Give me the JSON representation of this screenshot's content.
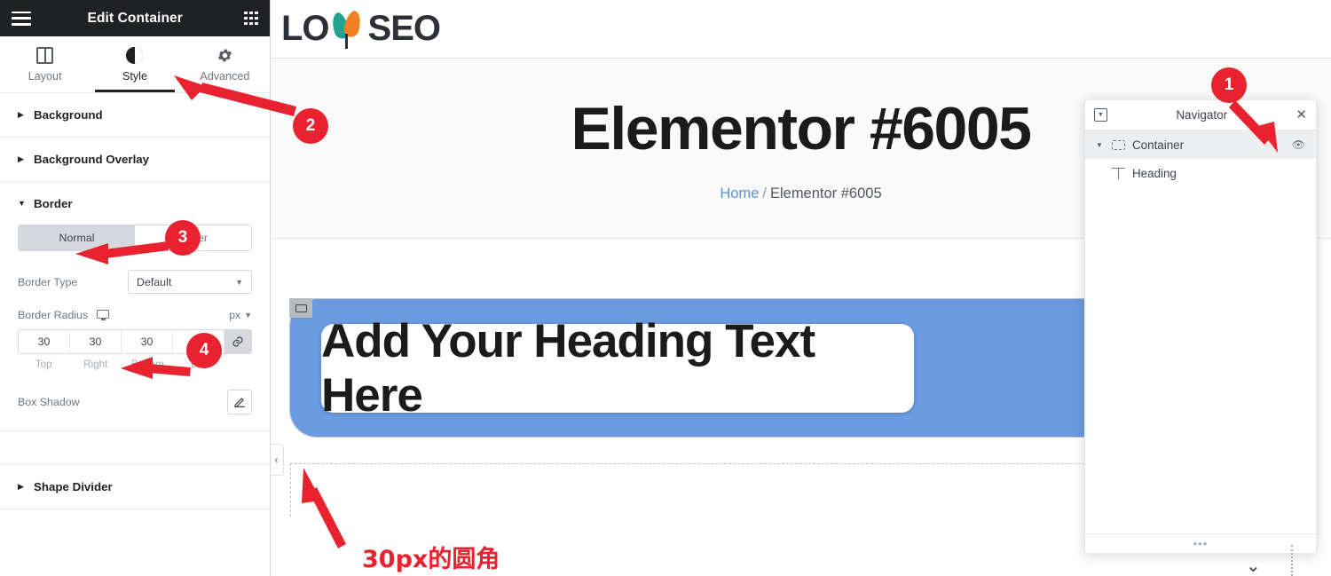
{
  "panel": {
    "title": "Edit Container",
    "menu_icon": "hamburger-icon",
    "apps_icon": "apps-grid-icon",
    "tabs": [
      {
        "label": "Layout",
        "icon": "columns-icon",
        "active": false
      },
      {
        "label": "Style",
        "icon": "contrast-icon",
        "active": true
      },
      {
        "label": "Advanced",
        "icon": "gear-icon",
        "active": false
      }
    ],
    "sections": [
      {
        "label": "Background",
        "expanded": false
      },
      {
        "label": "Background Overlay",
        "expanded": false
      },
      {
        "label": "Border",
        "expanded": true
      },
      {
        "label": "Shape Divider",
        "expanded": false
      }
    ],
    "border": {
      "state_tabs": [
        {
          "label": "Normal",
          "active": true
        },
        {
          "label": "Hover",
          "active": false
        }
      ],
      "border_type_label": "Border Type",
      "border_type_value": "Default",
      "border_radius_label": "Border Radius",
      "device_icon": "monitor-icon",
      "unit": "px",
      "radius_values": [
        "30",
        "30",
        "30",
        "30"
      ],
      "radius_labels": [
        "Top",
        "Right",
        "Bottom",
        "Left"
      ],
      "link_icon": "link-icon",
      "box_shadow_label": "Box Shadow",
      "box_shadow_edit_icon": "pencil-icon"
    },
    "collapse_icon": "chevron-left-icon"
  },
  "site": {
    "logo_text_left": "LO",
    "logo_text_right": "SEO",
    "logo_leaf_colors": {
      "left": "#22a390",
      "right": "#ef8023"
    },
    "page_title": "Elementor #6005",
    "breadcrumb": {
      "home": "Home",
      "separator": "/",
      "current": "Elementor #6005"
    }
  },
  "canvas": {
    "container_handle_icon": "container-icon",
    "container_color": "#6a9ae0",
    "container_radius_px": 30,
    "heading_text": "Add Your Heading Text Here"
  },
  "navigator": {
    "dock_icon": "dock-icon",
    "title": "Navigator",
    "close_icon": "close-icon",
    "items": [
      {
        "label": "Container",
        "icon": "container-icon",
        "selected": true,
        "visibility_icon": "eye-icon",
        "caret": "chevron-down-icon"
      },
      {
        "label": "Heading",
        "icon": "heading-icon",
        "selected": false
      }
    ],
    "resize_handle": "•••",
    "bottom_chevron_icon": "chevron-down-icon"
  },
  "annotations": {
    "accent_color": "#e8222e",
    "badges": [
      {
        "number": "1",
        "target": "navigator-container-item"
      },
      {
        "number": "2",
        "target": "style-tab"
      },
      {
        "number": "3",
        "target": "border-section"
      },
      {
        "number": "4",
        "target": "border-radius-control"
      }
    ],
    "note_text": "30px的圆角"
  }
}
